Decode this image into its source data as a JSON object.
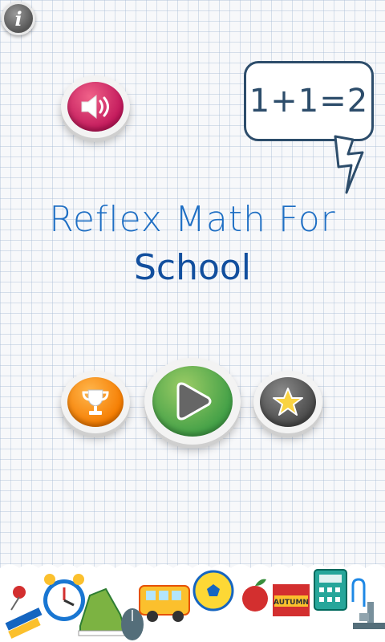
{
  "info_button": {
    "glyph": "i",
    "icon": "info-icon"
  },
  "sound_button": {
    "icon": "speaker-icon",
    "color": "#c2185b"
  },
  "bubble": {
    "text": "1+1=2"
  },
  "title": {
    "line1": "Reflex Math For",
    "line2": "School"
  },
  "buttons": {
    "leaderboard": {
      "icon": "trophy-icon",
      "color": "#f57c00"
    },
    "play": {
      "icon": "play-icon",
      "color": "#43a047"
    },
    "rate": {
      "icon": "star-icon",
      "color": "#4a4a4a"
    }
  },
  "footer": {
    "calendar_label": "AUTUMN",
    "items": [
      "pushpin-icon",
      "alarm-clock-icon",
      "sneaker-icon",
      "mouse-icon",
      "school-bus-icon",
      "soccer-ball-icon",
      "apple-icon",
      "calendar-icon",
      "calculator-icon",
      "paperclip-icon",
      "microscope-icon"
    ]
  }
}
